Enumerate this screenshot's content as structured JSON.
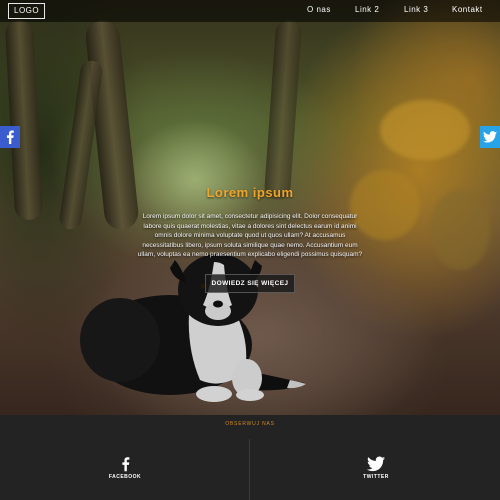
{
  "nav": {
    "logo": "LOGO",
    "items": [
      {
        "label": "O nas"
      },
      {
        "label": "Link 2"
      },
      {
        "label": "Link 3"
      },
      {
        "label": "Kontakt"
      }
    ]
  },
  "hero": {
    "title": "Lorem ipsum",
    "text": "Lorem ipsum dolor sit amet, consectetur adipisicing elit. Dolor consequatur labore quis quaerat molestias, vitae a dolores sint delectus earum id animi omnis dolore minima voluptate quod ut quos ullam? At accusamus necessitatibus libero, ipsum soluta similique quae nemo. Accusantium eum ullam, voluptas ea nemo praesentium explicabo eligendi possimus quisquam?",
    "cta_label": "DOWIEDZ SIĘ WIĘCEJ"
  },
  "side_social": {
    "left_icon": "facebook-icon",
    "right_icon": "twitter-icon"
  },
  "footer": {
    "title": "OBSERWUJ NAS",
    "social": [
      {
        "label": "FACEBOOK",
        "icon": "facebook-icon"
      },
      {
        "label": "TWITTER",
        "icon": "twitter-icon"
      }
    ]
  },
  "colors": {
    "accent": "#f0a52a",
    "facebook": "#3b5ccf",
    "twitter": "#29a3e8",
    "footer_bg": "#232323"
  }
}
